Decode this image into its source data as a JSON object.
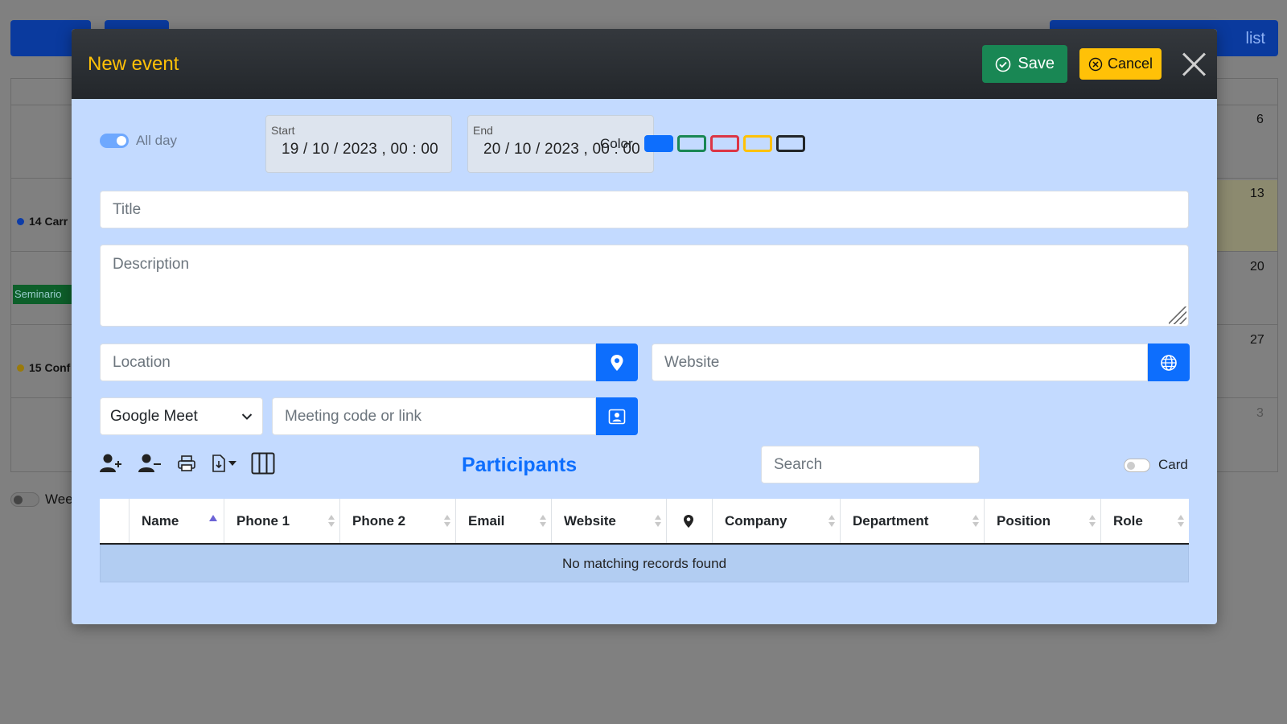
{
  "background": {
    "nav_prev": "‹",
    "nav_next": "›",
    "view_list": "list",
    "day_numbers": [
      "6",
      "13",
      "20",
      "27",
      "3"
    ],
    "events": [
      {
        "text": "14 Carr",
        "color": "#0d3ca8"
      },
      {
        "text": "15 Conf",
        "color": "#9a7a0a"
      }
    ],
    "seminario": "Seminario",
    "week_toggle_label": "Wee"
  },
  "modal": {
    "title": "New event",
    "save_label": "Save",
    "cancel_label": "Cancel",
    "allday_label": "All day",
    "start": {
      "label": "Start",
      "value": "19 / 10 / 2023 ,  00 : 00"
    },
    "end": {
      "label": "End",
      "value": "20 / 10 / 2023 ,  00 : 00"
    },
    "color_label": "Color",
    "colors": [
      "#0d6efd",
      "#198754",
      "#dc3545",
      "#ffc107",
      "#212529"
    ],
    "title_placeholder": "Title",
    "description_placeholder": "Description",
    "location_placeholder": "Location",
    "website_placeholder": "Website",
    "meeting_platform": "Google Meet",
    "meeting_placeholder": "Meeting code or link",
    "participants_heading": "Participants",
    "search_placeholder": "Search",
    "card_label": "Card",
    "toolbar_icons": [
      "add-user-icon",
      "remove-user-icon",
      "print-icon",
      "export-icon",
      "columns-icon"
    ],
    "table": {
      "columns": [
        "",
        "Name",
        "Phone 1",
        "Phone 2",
        "Email",
        "Website",
        "",
        "Company",
        "Department",
        "Position",
        "Role"
      ],
      "empty_message": "No matching records found"
    }
  }
}
